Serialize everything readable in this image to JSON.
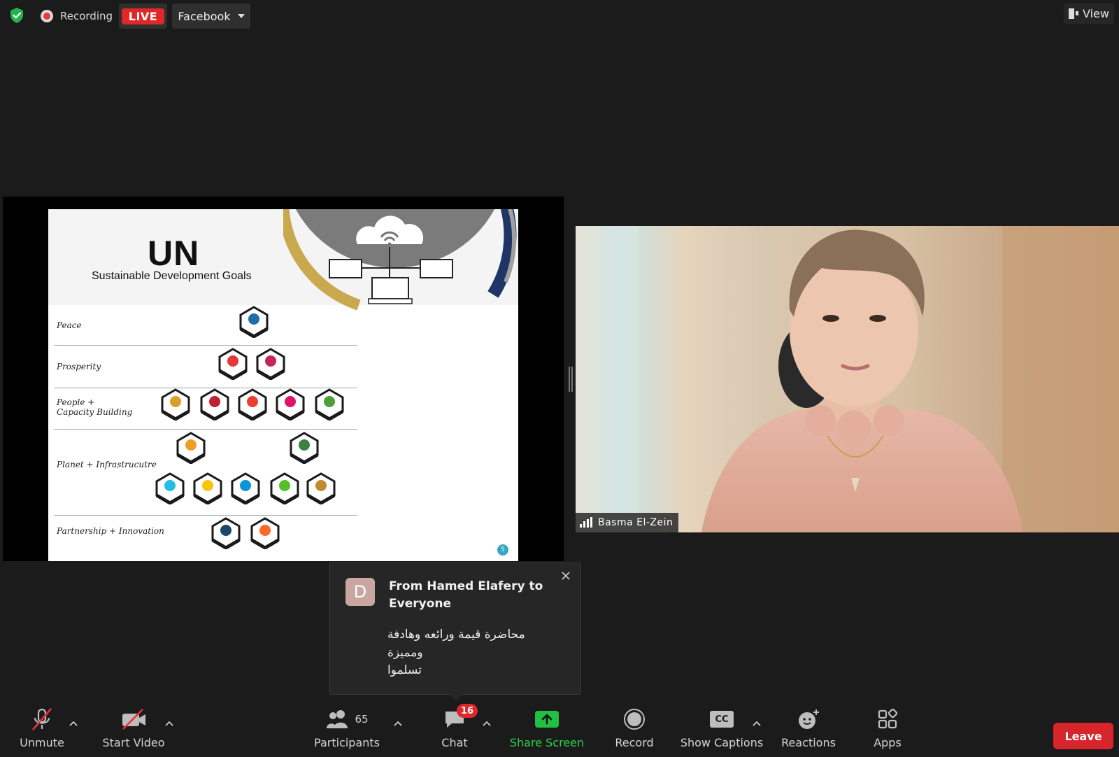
{
  "top_bar": {
    "recording_label": "Recording",
    "live_label": "LIVE",
    "stream_target": "Facebook",
    "view_label": "View"
  },
  "slide": {
    "title": "UN",
    "subtitle": "Sustainable Development Goals",
    "rows": [
      {
        "label": "Peace"
      },
      {
        "label": "Prosperity"
      },
      {
        "label": "People +\nCapacity Building"
      },
      {
        "label": "Planet + Infrastrucutre"
      },
      {
        "label": "Partnership + Innovation"
      }
    ],
    "page_number": "5"
  },
  "video": {
    "participant_name": "Basma El-Zein"
  },
  "chat_popup": {
    "avatar_letter": "D",
    "from": "From Hamed Elafery to Everyone",
    "message": "محاضرة قيمة ورائعه وهادفة\nومميزة\nتسلموا"
  },
  "toolbar": {
    "unmute": "Unmute",
    "start_video": "Start Video",
    "participants": "Participants",
    "participants_count": "65",
    "chat": "Chat",
    "chat_badge": "16",
    "share_screen": "Share Screen",
    "record": "Record",
    "show_captions": "Show Captions",
    "captions_icon_text": "CC",
    "reactions": "Reactions",
    "apps": "Apps",
    "leave": "Leave"
  },
  "colors": {
    "background": "#1b1b1b",
    "live_red": "#e02828",
    "share_green": "#2bd24a",
    "leave_red": "#d7262b",
    "badge_red": "#e0282c"
  },
  "icons": [
    "shield-check-icon",
    "recording-dot-icon",
    "view-layout-icon",
    "mic-muted-icon",
    "video-off-icon",
    "participants-icon",
    "chat-bubble-icon",
    "share-screen-arrow-icon",
    "record-icon",
    "captions-icon",
    "reactions-icon",
    "apps-icon",
    "close-icon",
    "chevron-up-icon",
    "signal-bars-icon"
  ]
}
